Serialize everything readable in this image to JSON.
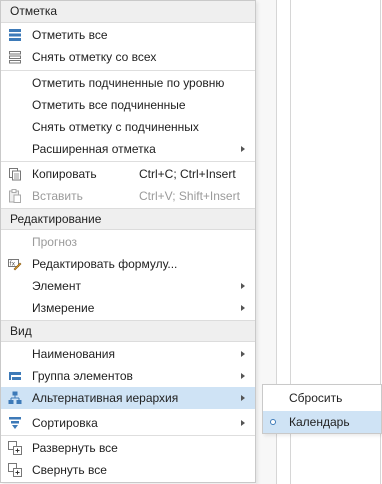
{
  "colors": {
    "highlight": "#cfe3f5",
    "header_bg": "#efefef",
    "icon_blue": "#3d7ab8"
  },
  "menu": {
    "sections": {
      "mark": "Отметка",
      "edit": "Редактирование",
      "view": "Вид"
    },
    "items": {
      "mark_all": "Отметить все",
      "unmark_all": "Снять отметку со всех",
      "mark_children_level": "Отметить подчиненные по уровню",
      "mark_all_children": "Отметить все подчиненные",
      "unmark_children": "Снять отметку с подчиненных",
      "advanced_mark": "Расширенная отметка",
      "copy": "Копировать",
      "copy_shortcut": "Ctrl+C; Ctrl+Insert",
      "paste": "Вставить",
      "paste_shortcut": "Ctrl+V; Shift+Insert",
      "forecast": "Прогноз",
      "edit_formula": "Редактировать формулу...",
      "element": "Элемент",
      "dimension": "Измерение",
      "names": "Наименования",
      "element_group": "Группа элементов",
      "alt_hierarchy": "Альтернативная иерархия",
      "sorting": "Сортировка",
      "expand_all": "Развернуть все",
      "collapse_all": "Свернуть все"
    }
  },
  "submenu": {
    "reset": "Сбросить",
    "calendar": "Календарь"
  }
}
